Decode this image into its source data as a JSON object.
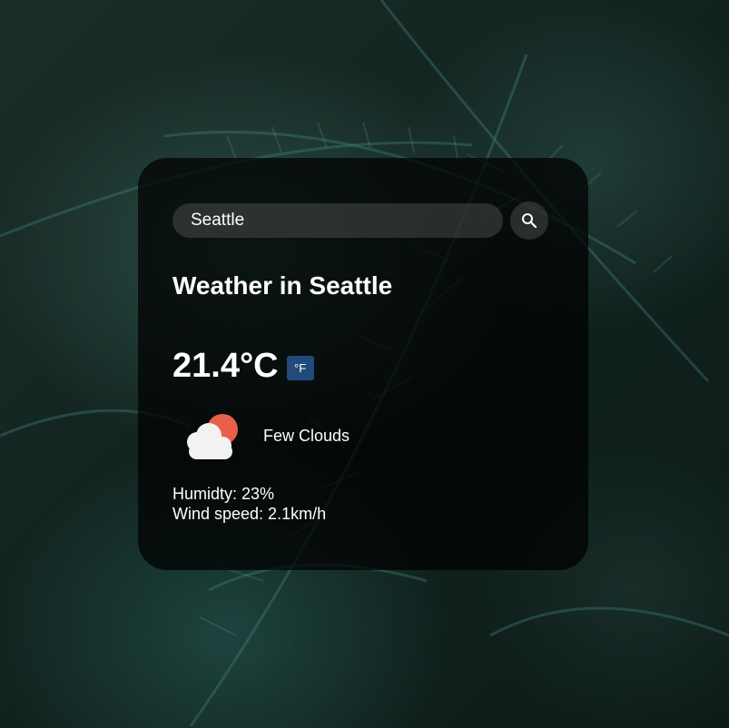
{
  "search": {
    "value": "Seattle",
    "button_icon": "search-icon"
  },
  "weather": {
    "title": "Weather in Seattle",
    "temperature": "21.4°C",
    "unit_toggle_label": "°F",
    "icon": "few-clouds-icon",
    "description": "Few Clouds",
    "humidity": "Humidty: 23%",
    "wind": "Wind speed: 2.1km/h"
  },
  "colors": {
    "card_background": "#000000",
    "unit_toggle": "#234a7a",
    "sun": "#e8604a",
    "cloud": "#f2f2f2"
  }
}
